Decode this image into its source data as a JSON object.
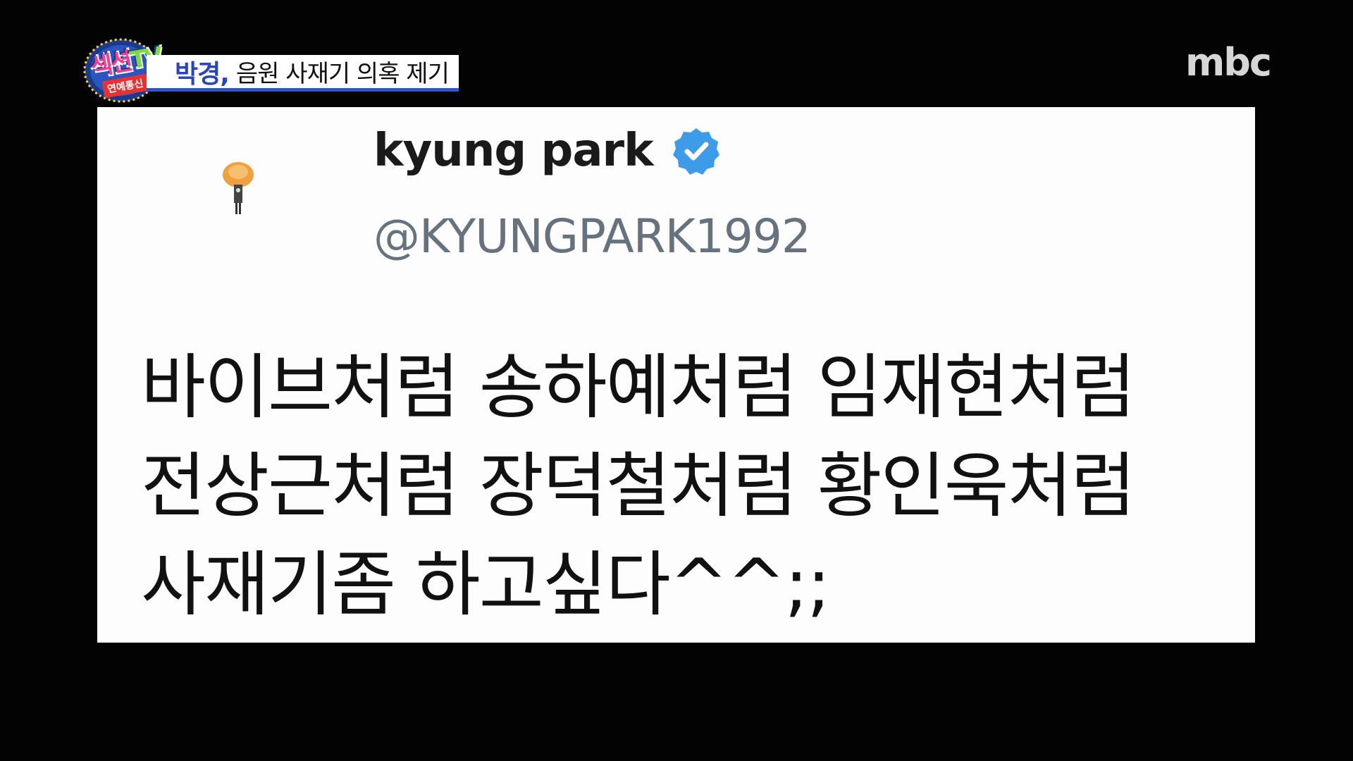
{
  "program": {
    "logo_main": "섹션",
    "logo_tv": "TV",
    "logo_sub": "연예통신"
  },
  "caption": {
    "name": "박경,",
    "text": "음원 사재기 의혹 제기"
  },
  "broadcaster": {
    "logo": "mbc"
  },
  "tweet": {
    "display_name": "kyung park",
    "verified_icon": "verified-check-icon",
    "handle": "@KYUNGPARK1992",
    "lines": [
      "바이브처럼 송하예처럼 임재현처럼",
      "전상근처럼 장덕철처럼 황인욱처럼",
      "사재기좀 하고싶다^^;;"
    ]
  },
  "colors": {
    "caption_accent": "#2a44c0",
    "verified_badge": "#3d9be9",
    "handle_gray": "#66737f"
  }
}
